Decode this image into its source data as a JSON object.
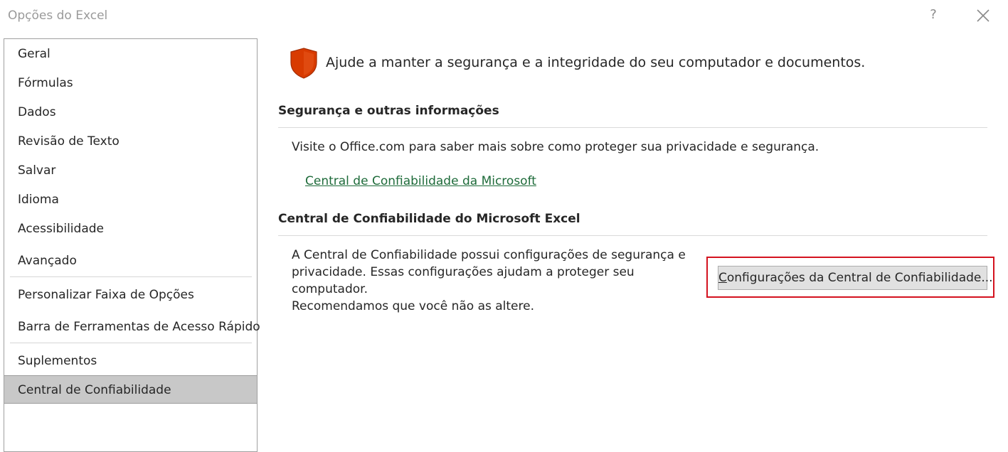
{
  "window": {
    "title": "Opções do Excel",
    "help_label": "?"
  },
  "sidebar": {
    "items": [
      {
        "label": "Geral",
        "selected": false
      },
      {
        "label": "Fórmulas",
        "selected": false
      },
      {
        "label": "Dados",
        "selected": false
      },
      {
        "label": "Revisão de Texto",
        "selected": false
      },
      {
        "label": "Salvar",
        "selected": false
      },
      {
        "label": "Idioma",
        "selected": false
      },
      {
        "label": "Acessibilidade",
        "selected": false
      },
      {
        "label": "Avançado",
        "selected": false
      },
      {
        "label": "Personalizar Faixa de Opções",
        "selected": false
      },
      {
        "label": "Barra de Ferramentas de Acesso Rápido",
        "selected": false
      },
      {
        "label": "Suplementos",
        "selected": false
      },
      {
        "label": "Central de Confiabilidade",
        "selected": true
      }
    ]
  },
  "main": {
    "headline": "Ajude a manter a segurança e a integridade do seu computador e documentos.",
    "section1": {
      "title": "Segurança e outras informações",
      "text": "Visite o Office.com para saber mais sobre como proteger sua privacidade e segurança.",
      "link": "Central de Confiabilidade da Microsoft"
    },
    "section2": {
      "title": "Central de Confiabilidade do Microsoft Excel",
      "lines": [
        "A Central de Confiabilidade possui configurações de segurança e",
        "privacidade. Essas configurações ajudam a proteger seu computador.",
        "Recomendamos que você não as altere."
      ],
      "button_mnemonic": "C",
      "button_rest": "onfigurações da Central de Confiabilidade..."
    }
  },
  "colors": {
    "shield": "#d83b01",
    "link": "#1e6b3a",
    "selected_bg": "#c8c8c8",
    "highlight_border": "#d4121f"
  }
}
